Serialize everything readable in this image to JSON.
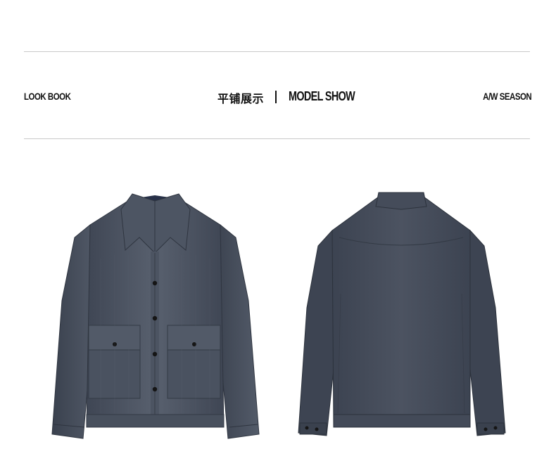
{
  "header": {
    "left_label": "LOOK BOOK",
    "center_cn": "平铺展示",
    "center_en": "MODEL SHOW",
    "right_label": "A/W SEASON"
  },
  "product": {
    "front_view": {
      "icon": "jacket-front-image",
      "color": "#4a5260"
    },
    "back_view": {
      "icon": "jacket-back-image",
      "color": "#454c5a"
    }
  }
}
